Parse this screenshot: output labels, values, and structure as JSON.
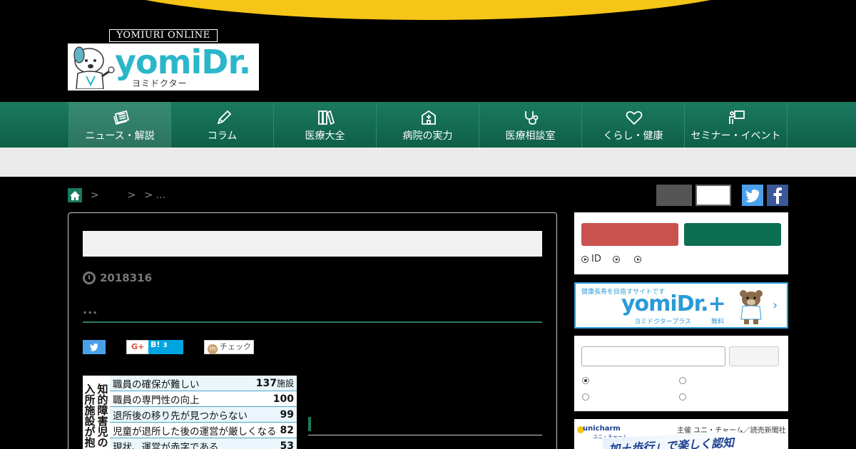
{
  "brand": {
    "online_label": "YOMIURI ONLINE",
    "logo_text": "yomiDr.",
    "logo_kana": "ヨミドクター"
  },
  "nav": {
    "items": [
      {
        "label": "ニュース・解説",
        "icon": "newspaper-icon"
      },
      {
        "label": "コラム",
        "icon": "pencil-icon"
      },
      {
        "label": "医療大全",
        "icon": "books-icon"
      },
      {
        "label": "病院の実力",
        "icon": "hospital-icon"
      },
      {
        "label": "医療相談室",
        "icon": "stethoscope-icon"
      },
      {
        "label": "くらし・健康",
        "icon": "heart-icon"
      },
      {
        "label": "セミナー・イベント",
        "icon": "presentation-icon"
      }
    ]
  },
  "breadcrumb": {
    "sep1": ">",
    "sep2": ">",
    "sep3": "> ..."
  },
  "article": {
    "date": "2018316",
    "dots": "..."
  },
  "share": {
    "gplus": "G+",
    "hatena": "B!",
    "hatena_count": "3",
    "check": "チェック",
    "check_mark": "m"
  },
  "figure": {
    "vertical_title_col1": "知的障害児の",
    "vertical_title_col2": "入所施設が抱",
    "rows": [
      {
        "label": "職員の確保が難しい",
        "value": "137",
        "unit": "施設"
      },
      {
        "label": "職員の専門性の向上",
        "value": "100",
        "unit": ""
      },
      {
        "label": "退所後の移り先が見つからない",
        "value": "99",
        "unit": ""
      },
      {
        "label": "児童が退所した後の運営が厳しくなる",
        "value": "82",
        "unit": ""
      },
      {
        "label": "現状、運営が赤字である",
        "value": "53",
        "unit": ""
      }
    ]
  },
  "sidebar": {
    "login_links": [
      "ID",
      "",
      ""
    ],
    "plus_tagline": "健康長寿を目指すサイトです",
    "plus_logo": "yomiDr.+",
    "plus_kana": "ヨミドクタープラス",
    "plus_free": "無料",
    "plus_chevron": "›",
    "banner_brand": "unicharm",
    "banner_brand_kana": "ユニ・チャーム",
    "banner_sponsor": "主催 ユニ・チャーム／読売新聞社",
    "banner_headline": "加＋歩行」で楽しく認知"
  },
  "colors": {
    "accent_green": "#1a7a5f",
    "brand_cyan": "#2bb7c9",
    "twitter": "#49a1eb",
    "facebook": "#3b5998",
    "top_arc": "#f5c518"
  }
}
